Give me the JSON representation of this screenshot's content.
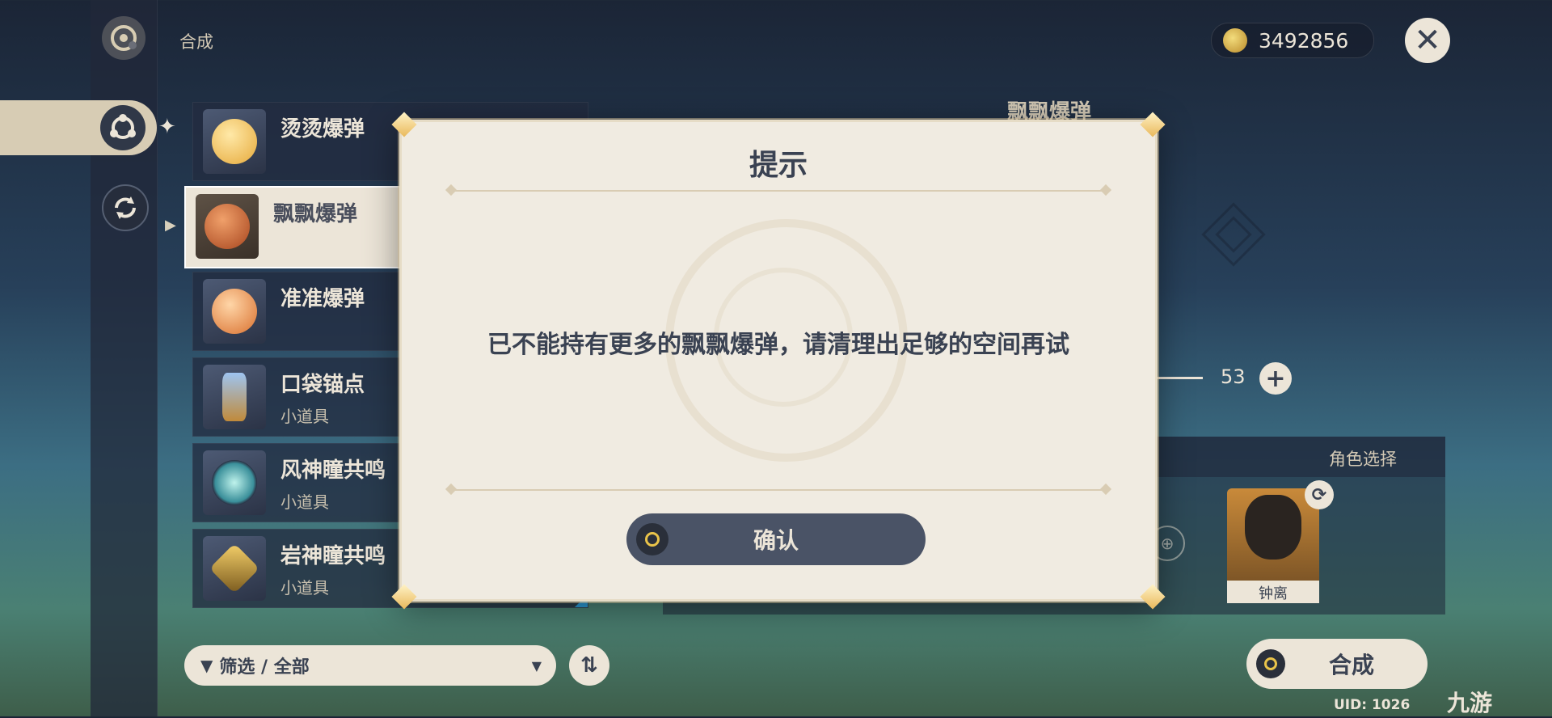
{
  "header": {
    "section_title": "合成",
    "currency_value": "3492856",
    "currency_icon": "mora-coin-icon",
    "close_icon": "close-icon"
  },
  "nav": {
    "items": [
      "crafting-icon",
      "alchemy-icon",
      "convert-icon"
    ]
  },
  "items": [
    {
      "name": "烫烫爆弹",
      "sub": "",
      "rarity_color": "#2b9bd8",
      "selected": false
    },
    {
      "name": "飘飘爆弹",
      "sub": "",
      "rarity_color": "#2b9bd8",
      "selected": true
    },
    {
      "name": "准准爆弹",
      "sub": "",
      "rarity_color": "#2b9bd8",
      "selected": false
    },
    {
      "name": "口袋锚点",
      "sub": "小道具",
      "rarity_color": "#a35fd1",
      "selected": false
    },
    {
      "name": "风神瞳共鸣",
      "sub": "小道具",
      "rarity_color": "#2b9bd8",
      "selected": false
    },
    {
      "name": "岩神瞳共鸣",
      "sub": "小道具",
      "rarity_color": "#2b9bd8",
      "selected": false
    }
  ],
  "filter": {
    "label": "筛选 / 全部"
  },
  "detail": {
    "title": "飘飘爆弹",
    "quantity": "53"
  },
  "character": {
    "header_label": "角色选择",
    "name": "钟离"
  },
  "craft_button": {
    "label": "合成"
  },
  "footer": {
    "uid": "UID: 1026",
    "watermark": "九游"
  },
  "dialog": {
    "title": "提示",
    "message": "已不能持有更多的飘飘爆弹，请清理出足够的空间再试",
    "confirm_label": "确认"
  },
  "colors": {
    "accent_gold": "#e9c34a",
    "panel_cream": "#f0ebe1",
    "button_dark": "#4a5366",
    "text_dark": "#3a4252"
  }
}
